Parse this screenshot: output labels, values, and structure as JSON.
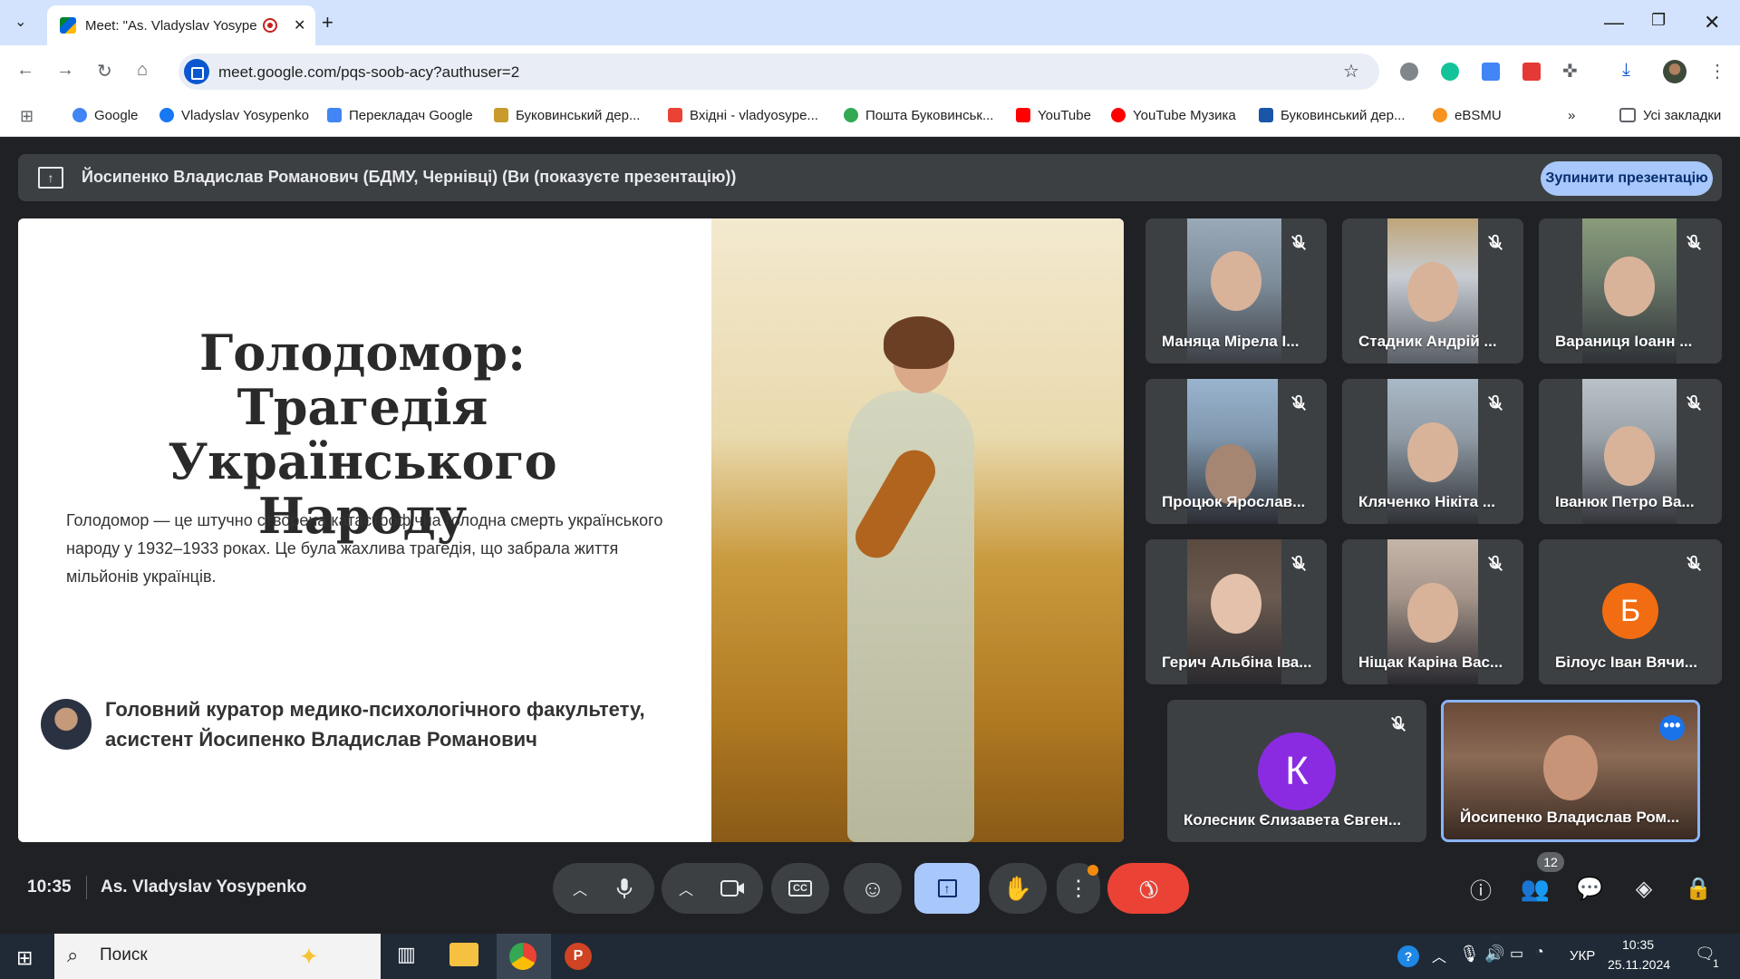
{
  "browser": {
    "tab_title": "Meet: \"As. Vladyslav Yosype",
    "url": "meet.google.com/pqs-soob-acy?authuser=2",
    "bookmarks": [
      {
        "label": "Google",
        "icon": "google-icon",
        "color": "#4285f4"
      },
      {
        "label": "Vladyslav Yosypenko",
        "icon": "facebook-icon",
        "color": "#1877f2"
      },
      {
        "label": "Перекладач Google",
        "icon": "translate-icon",
        "color": "#4285f4"
      },
      {
        "label": "Буковинський дер...",
        "icon": "university-icon",
        "color": "#c89b2c"
      },
      {
        "label": "Вхідні - vladyosype...",
        "icon": "gmail-icon",
        "color": "#ea4335"
      },
      {
        "label": "Пошта Буковинськ...",
        "icon": "google-icon",
        "color": "#34a853"
      },
      {
        "label": "YouTube",
        "icon": "youtube-icon",
        "color": "#ff0000"
      },
      {
        "label": "YouTube Музика",
        "icon": "youtube-music-icon",
        "color": "#ff0000"
      },
      {
        "label": "Буковинський дер...",
        "icon": "university-icon",
        "color": "#1a56a8"
      },
      {
        "label": "eBSMU",
        "icon": "moodle-icon",
        "color": "#f7931e"
      }
    ],
    "all_bookmarks": "Усі закладки"
  },
  "banner": {
    "text": "Йосипенко Владислав Романович (БДМУ, Чернівці) (Ви (показуєте презентацію))",
    "stop_button": "Зупинити презентацію"
  },
  "slide": {
    "title": "Голодомор: Трагедія Українського Народу",
    "body": "Голодомор — це штучно створена катастрофічна голодна смерть українського народу у 1932–1933 роках. Це була жахлива трагедія, що забрала життя мільйонів українців.",
    "author": "Головний куратор медико-психологічного факультету, асистент Йосипенко Владислав Романович"
  },
  "participants": [
    {
      "name": "Маняца Мірела І..."
    },
    {
      "name": "Стадник Андрій ..."
    },
    {
      "name": "Вараниця Іоанн ..."
    },
    {
      "name": "Процюк Ярослав..."
    },
    {
      "name": "Кляченко Нікіта ..."
    },
    {
      "name": "Іванюк Петро Ва..."
    },
    {
      "name": "Герич Альбіна Іва..."
    },
    {
      "name": "Ніщак Каріна Вас..."
    },
    {
      "name": "Білоус Іван Вячи...",
      "initial": "Б",
      "color": "#f26c11"
    },
    {
      "name": "Колесник Єлизавета Євген...",
      "initial": "К",
      "color": "#8a2be2"
    },
    {
      "name": "Йосипенко Владислав Ром..."
    }
  ],
  "controls": {
    "time": "10:35",
    "meeting_name": "As. Vladyslav Yosypenko",
    "participant_count": "12"
  },
  "taskbar": {
    "search_placeholder": "Поиск",
    "language": "УКР",
    "time": "10:35",
    "date": "25.11.2024",
    "notifications": "1"
  }
}
